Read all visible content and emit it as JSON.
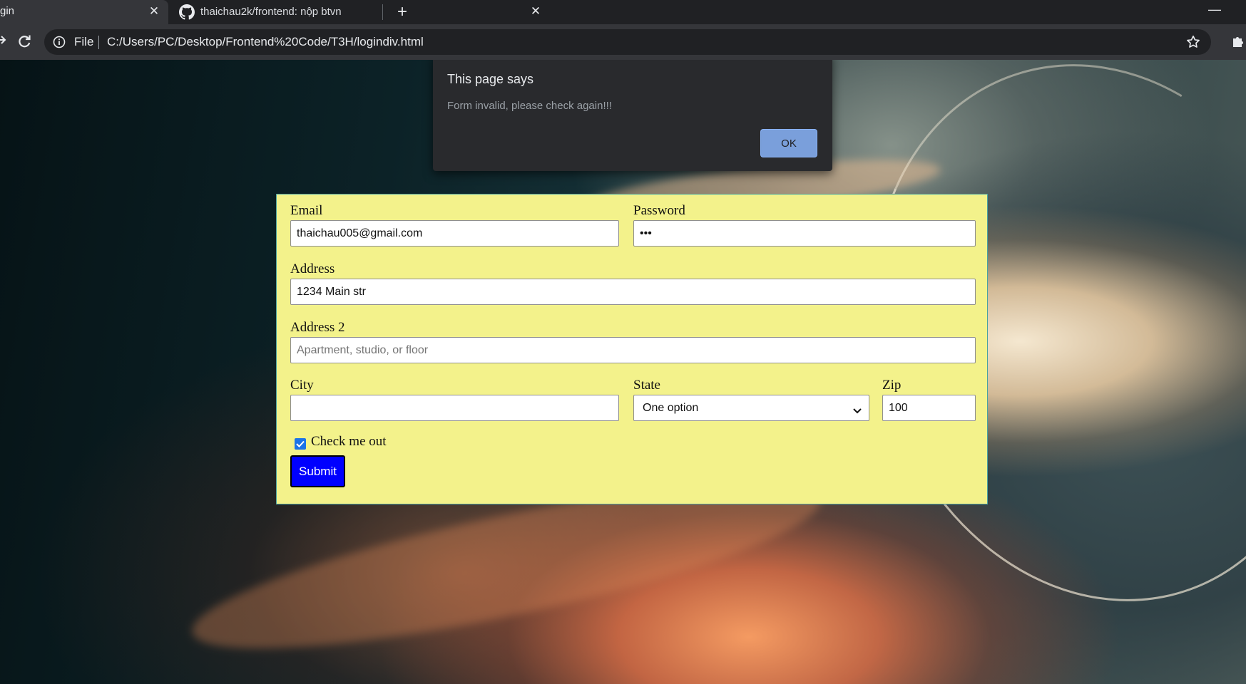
{
  "browser": {
    "tabs": [
      {
        "title": "gin",
        "active": true
      },
      {
        "title": "thaichau2k/frontend: nộp btvn",
        "active": false,
        "icon": "github-icon"
      }
    ],
    "new_tab_label": "+",
    "close_label": "✕",
    "minimize_label": "—",
    "omnibox": {
      "scheme_label": "File",
      "url": "C:/Users/PC/Desktop/Frontend%20Code/T3H/logindiv.html"
    }
  },
  "form": {
    "background": "#f3f28b",
    "email": {
      "label": "Email",
      "value": "thaichau005@gmail.com"
    },
    "password": {
      "label": "Password",
      "value": "•••"
    },
    "address": {
      "label": "Address",
      "value": "1234 Main str"
    },
    "address2": {
      "label": "Address 2",
      "value": "",
      "placeholder": "Apartment, studio, or floor"
    },
    "city": {
      "label": "City",
      "value": ""
    },
    "state": {
      "label": "State",
      "selected": "One option"
    },
    "zip": {
      "label": "Zip",
      "value": "100"
    },
    "checkbox": {
      "label": "Check me out",
      "checked": true
    },
    "submit_label": "Submit",
    "submit_color": "#0000ff"
  },
  "dialog": {
    "title": "This page says",
    "message": "Form invalid, please check again!!!",
    "ok_label": "OK"
  }
}
